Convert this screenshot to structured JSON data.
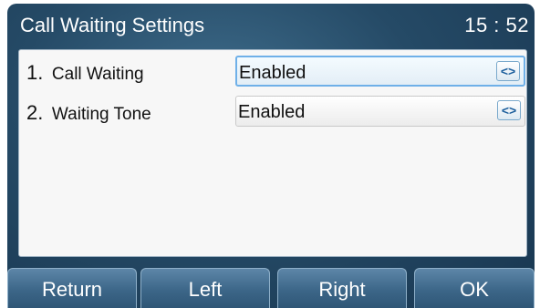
{
  "header": {
    "title": "Call Waiting Settings",
    "time": "15 : 52"
  },
  "settings": [
    {
      "number": "1.",
      "label": "Call Waiting",
      "value": "Enabled",
      "control_glyph": "<>",
      "focused": true
    },
    {
      "number": "2.",
      "label": "Waiting Tone",
      "value": "Enabled",
      "control_glyph": "<>",
      "focused": false
    }
  ],
  "softkeys": [
    {
      "label": "Return"
    },
    {
      "label": "Left"
    },
    {
      "label": "Right"
    },
    {
      "label": "OK"
    }
  ],
  "colors": {
    "background_dark": "#254a66",
    "focus_border": "#6fb0e8",
    "arrow_color": "#1b5e9c"
  }
}
